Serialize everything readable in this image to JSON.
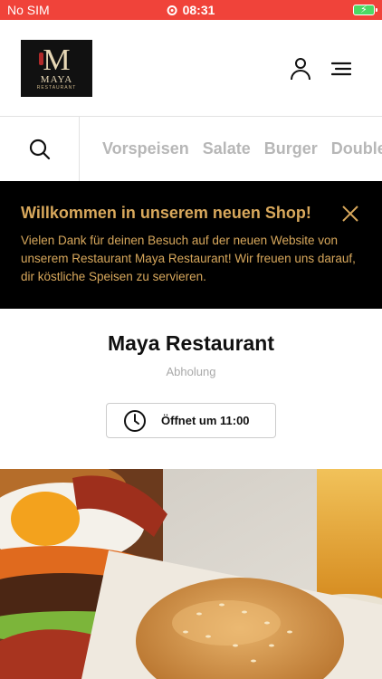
{
  "status": {
    "carrier": "No SIM",
    "time": "08:31"
  },
  "header": {
    "logo_letter": "M",
    "logo_name": "MAYA",
    "logo_sub": "RESTAURANT",
    "user_icon": "user-icon",
    "menu_icon": "menu-icon"
  },
  "categories": {
    "items": [
      "Vorspeisen",
      "Salate",
      "Burger",
      "Double"
    ]
  },
  "banner": {
    "title": "Willkommen in unserem neuen Shop!",
    "text": "Vielen Dank für deinen Besuch auf der neuen Website von unserem Restaurant Maya Restaurant! Wir freuen uns darauf, dir köstliche Speisen zu servieren."
  },
  "restaurant": {
    "name": "Maya Restaurant",
    "mode": "Abholung",
    "opens": "Öffnet um 11:00"
  },
  "colors": {
    "status_bar": "#f0433a",
    "banner_text": "#d8a85c",
    "category_text": "#b7b7b7"
  }
}
